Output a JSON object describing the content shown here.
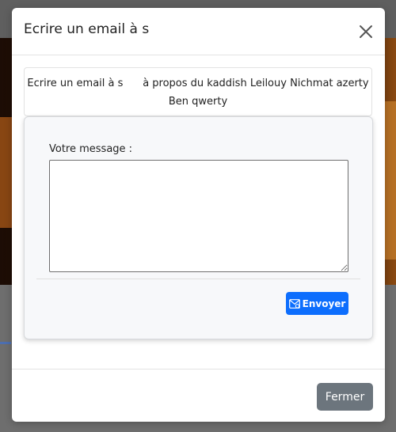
{
  "modal": {
    "title": "Ecrire un email à s       ",
    "intro_text": "Ecrire un email à s      à propos du kaddish Leilouy Nichmat azerty Ben qwerty",
    "form": {
      "message_label": "Votre message :",
      "message_value": "",
      "send_label": "Envoyer"
    },
    "footer": {
      "close_label": "Fermer"
    }
  },
  "colors": {
    "primary_button": "#0d6efd",
    "secondary_button": "#6c757d"
  },
  "icons": {
    "close": "close-icon",
    "send": "envelope-icon"
  }
}
